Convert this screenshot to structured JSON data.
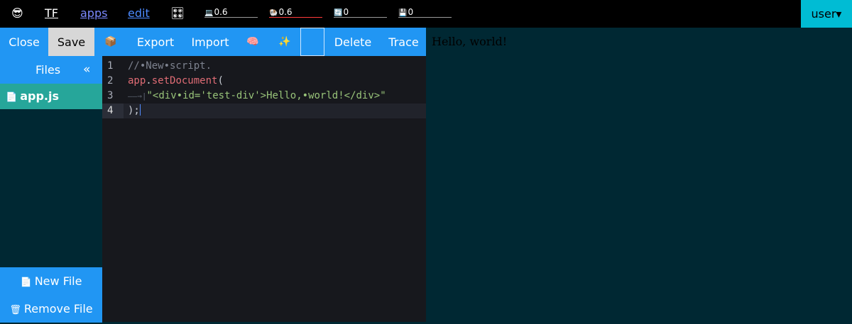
{
  "topbar": {
    "emoji": "😎",
    "tf_label": "TF",
    "apps_label": "apps",
    "edit_label": "edit",
    "grid_icon": "🎛",
    "meters": {
      "cpu": {
        "icon": "💻",
        "value": "0.6"
      },
      "mem": {
        "icon": "🐏",
        "value": "0.6"
      },
      "net": {
        "icon": "🔄",
        "value": "0"
      },
      "disk": {
        "icon": "💾",
        "value": "0"
      }
    },
    "user_label": "user▾"
  },
  "toolbar": {
    "close_label": "Close",
    "save_label": "Save",
    "package_icon": "📦",
    "export_label": "Export",
    "import_label": "Import",
    "brain_icon": "🧠",
    "sparkle_icon": "✨",
    "delete_label": "Delete",
    "trace_label": "Trace"
  },
  "sidebar": {
    "title": "Files",
    "collapse_icon": "«",
    "files": [
      {
        "icon": "📄",
        "name": "app.js"
      }
    ],
    "new_file": {
      "icon": "📄",
      "label": "New File"
    },
    "remove_file": {
      "icon": "🗑",
      "label": "Remove File"
    }
  },
  "editor": {
    "lines": [
      {
        "num": "1",
        "comment": "//•New•script."
      },
      {
        "num": "2",
        "obj": "app",
        "dot": ".",
        "method": "setDocument",
        "paren": "("
      },
      {
        "num": "3",
        "indent": "——→|",
        "string": "\"<div•id='test-div'>Hello,•world!</div>\""
      },
      {
        "num": "4",
        "close": ");"
      }
    ]
  },
  "preview": {
    "text": "Hello, world!"
  }
}
